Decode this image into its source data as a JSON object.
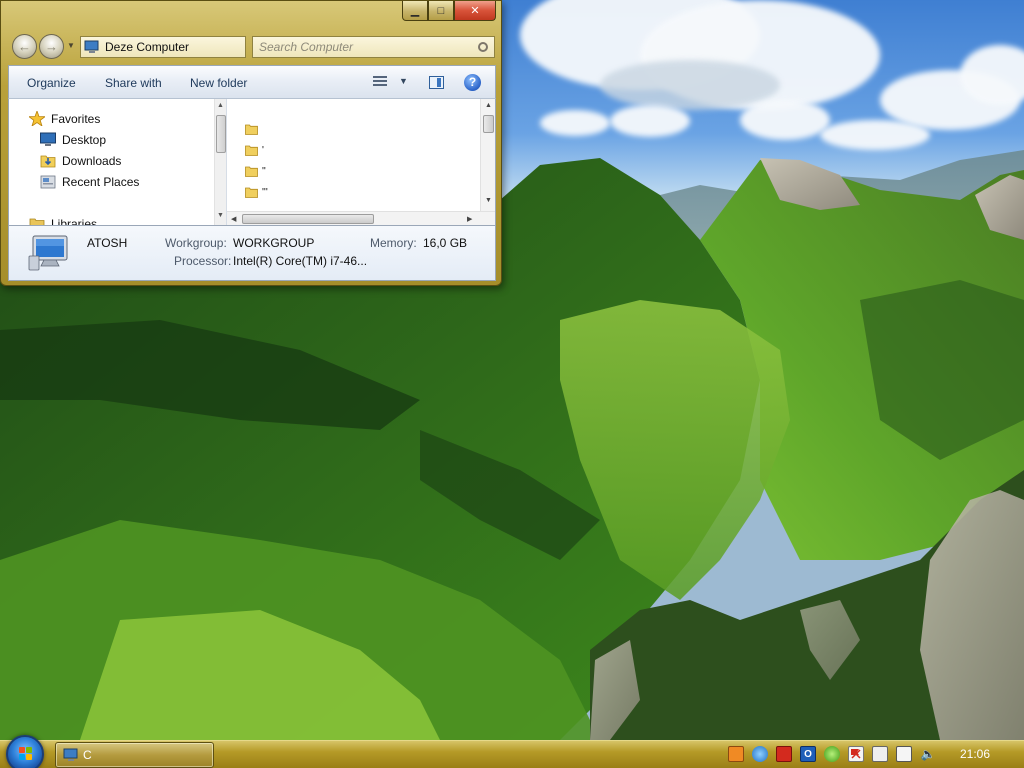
{
  "explorer": {
    "address": "Deze Computer",
    "search_placeholder": "Search Computer",
    "toolbar": {
      "organize": "Organize",
      "share_with": "Share with",
      "new_folder": "New folder"
    },
    "nav_pane": {
      "favorites": "Favorites",
      "desktop": "Desktop",
      "downloads": "Downloads",
      "recent_places": "Recent Places",
      "libraries": "Libraries"
    },
    "content_items": [
      "",
      "'",
      "''",
      "'''"
    ],
    "details": {
      "computer_name": "ATOSH",
      "workgroup_label": "Workgroup:",
      "workgroup_value": "WORKGROUP",
      "memory_label": "Memory:",
      "memory_value": "16,0 GB",
      "processor_label": "Processor:",
      "processor_value": "Intel(R) Core(TM) i7-46..."
    }
  },
  "taskbar": {
    "task_button_label": "C",
    "clock": "21:06",
    "tray_icons": [
      "app-icon",
      "network-icon",
      "acrobat-icon",
      "outlook-icon",
      "security-shield-icon",
      "flag-icon",
      "usb-icon",
      "display-icon",
      "volume-icon"
    ]
  },
  "colors": {
    "window_frame": "#b9a13a",
    "taskbar": "#b59a27",
    "toolbar_text": "#1e395b"
  }
}
